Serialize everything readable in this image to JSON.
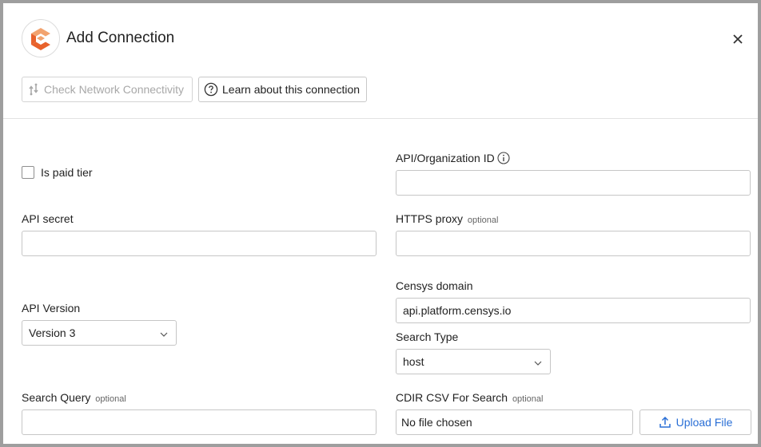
{
  "dialog": {
    "title": "Add Connection",
    "logo_icon": "censys-logo-icon",
    "close_icon": "close-icon"
  },
  "toolbar": {
    "check_network_label": "Check Network Connectivity",
    "learn_label": "Learn about this connection"
  },
  "form": {
    "is_paid_tier": {
      "label": "Is paid tier",
      "checked": false
    },
    "api_org_id": {
      "label": "API/Organization ID",
      "value": ""
    },
    "api_secret": {
      "label": "API secret",
      "value": ""
    },
    "https_proxy": {
      "label": "HTTPS proxy",
      "optional": "optional",
      "value": ""
    },
    "censys_domain": {
      "label": "Censys domain",
      "value": "api.platform.censys.io"
    },
    "api_version": {
      "label": "API Version",
      "value": "Version 3"
    },
    "search_type": {
      "label": "Search Type",
      "value": "host"
    },
    "search_query": {
      "label": "Search Query",
      "optional": "optional",
      "value": ""
    },
    "cdir_csv": {
      "label": "CDIR CSV For Search",
      "optional": "optional",
      "file_text": "No file chosen",
      "upload_label": "Upload File"
    }
  },
  "colors": {
    "accent": "#2a6fd6",
    "logo_orange": "#e8622c",
    "logo_light": "#f2a36f"
  }
}
